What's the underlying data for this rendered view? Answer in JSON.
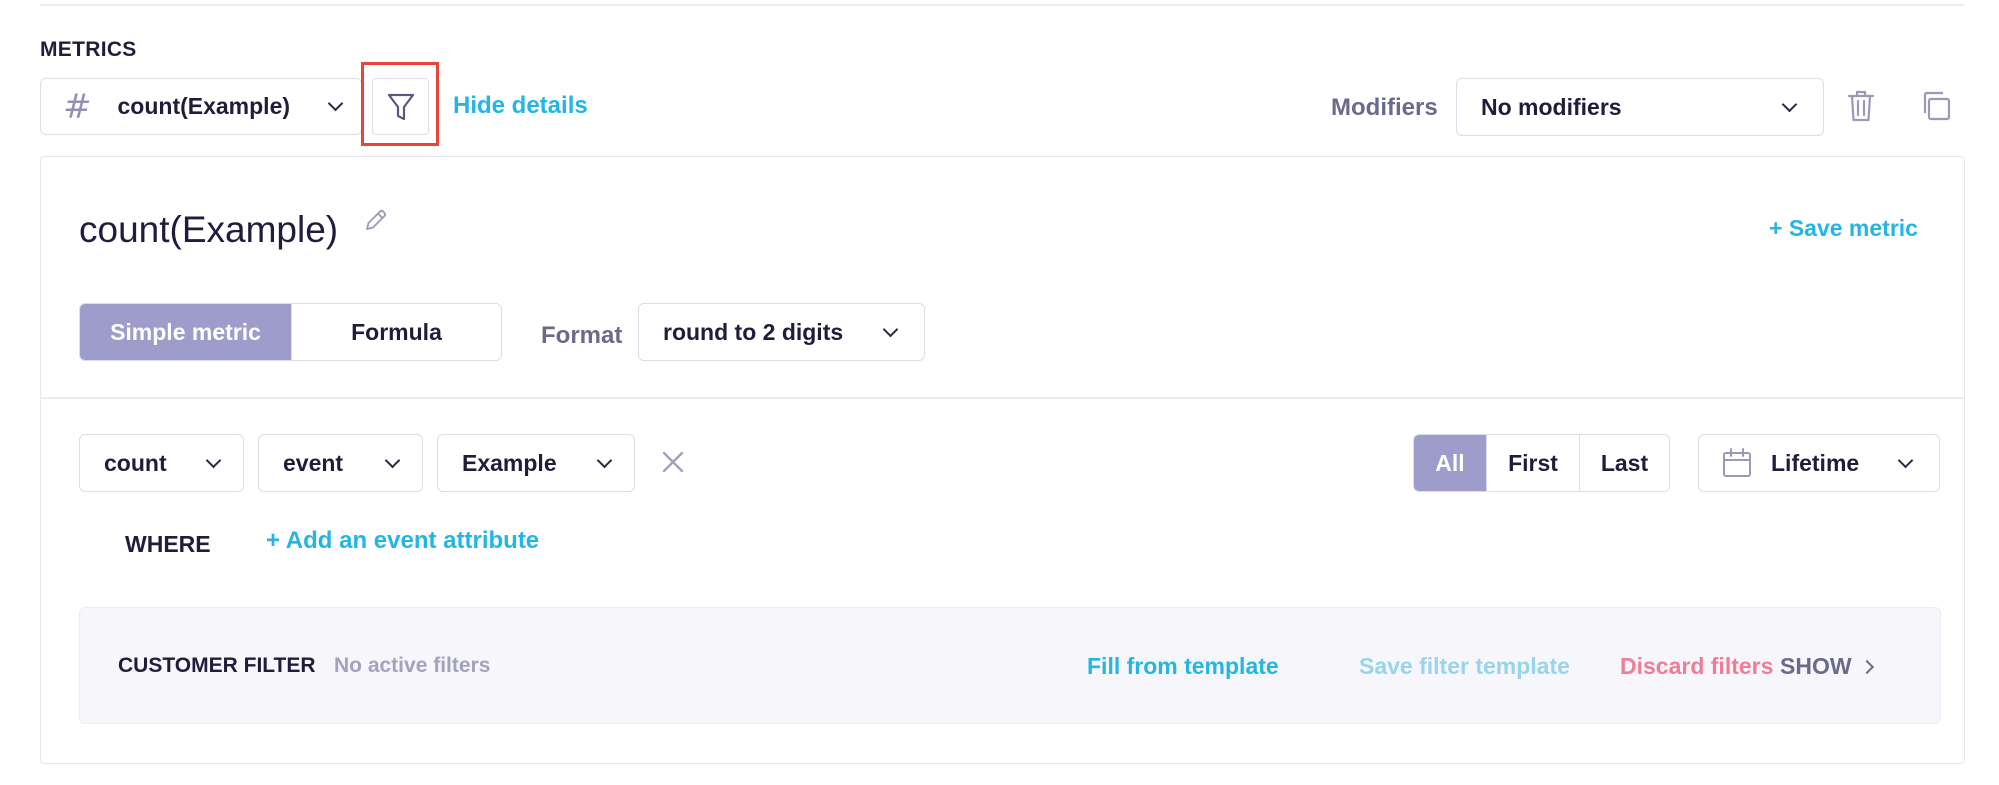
{
  "section": {
    "title": "METRICS"
  },
  "metric_select": {
    "icon": "hash-icon",
    "value": "count(Example)"
  },
  "toolbar": {
    "hide_details": "Hide details",
    "modifiers_label": "Modifiers",
    "modifiers_value": "No modifiers"
  },
  "metric": {
    "title": "count(Example)",
    "save_link": "+ Save metric",
    "type_tabs": [
      {
        "label": "Simple metric",
        "active": true
      },
      {
        "label": "Formula",
        "active": false
      }
    ],
    "format_label": "Format",
    "format_value": "round to 2 digits"
  },
  "query": {
    "aggregation": "count",
    "source": "event",
    "event_name": "Example",
    "range_tabs": [
      {
        "label": "All",
        "active": true
      },
      {
        "label": "First",
        "active": false
      },
      {
        "label": "Last",
        "active": false
      }
    ],
    "date_range": "Lifetime",
    "where_label": "WHERE",
    "add_attribute": "+ Add an event attribute"
  },
  "customer_filter": {
    "label": "CUSTOMER FILTER",
    "status": "No active filters",
    "fill_template": "Fill from template",
    "save_template": "Save filter template",
    "discard": "Discard filters",
    "show": "SHOW"
  },
  "colors": {
    "accent": "#23b6e3",
    "accent_disabled": "#98d5ec",
    "danger": "#f07c96",
    "active_segment": "#9e9cca",
    "highlight": "#e8453a"
  }
}
